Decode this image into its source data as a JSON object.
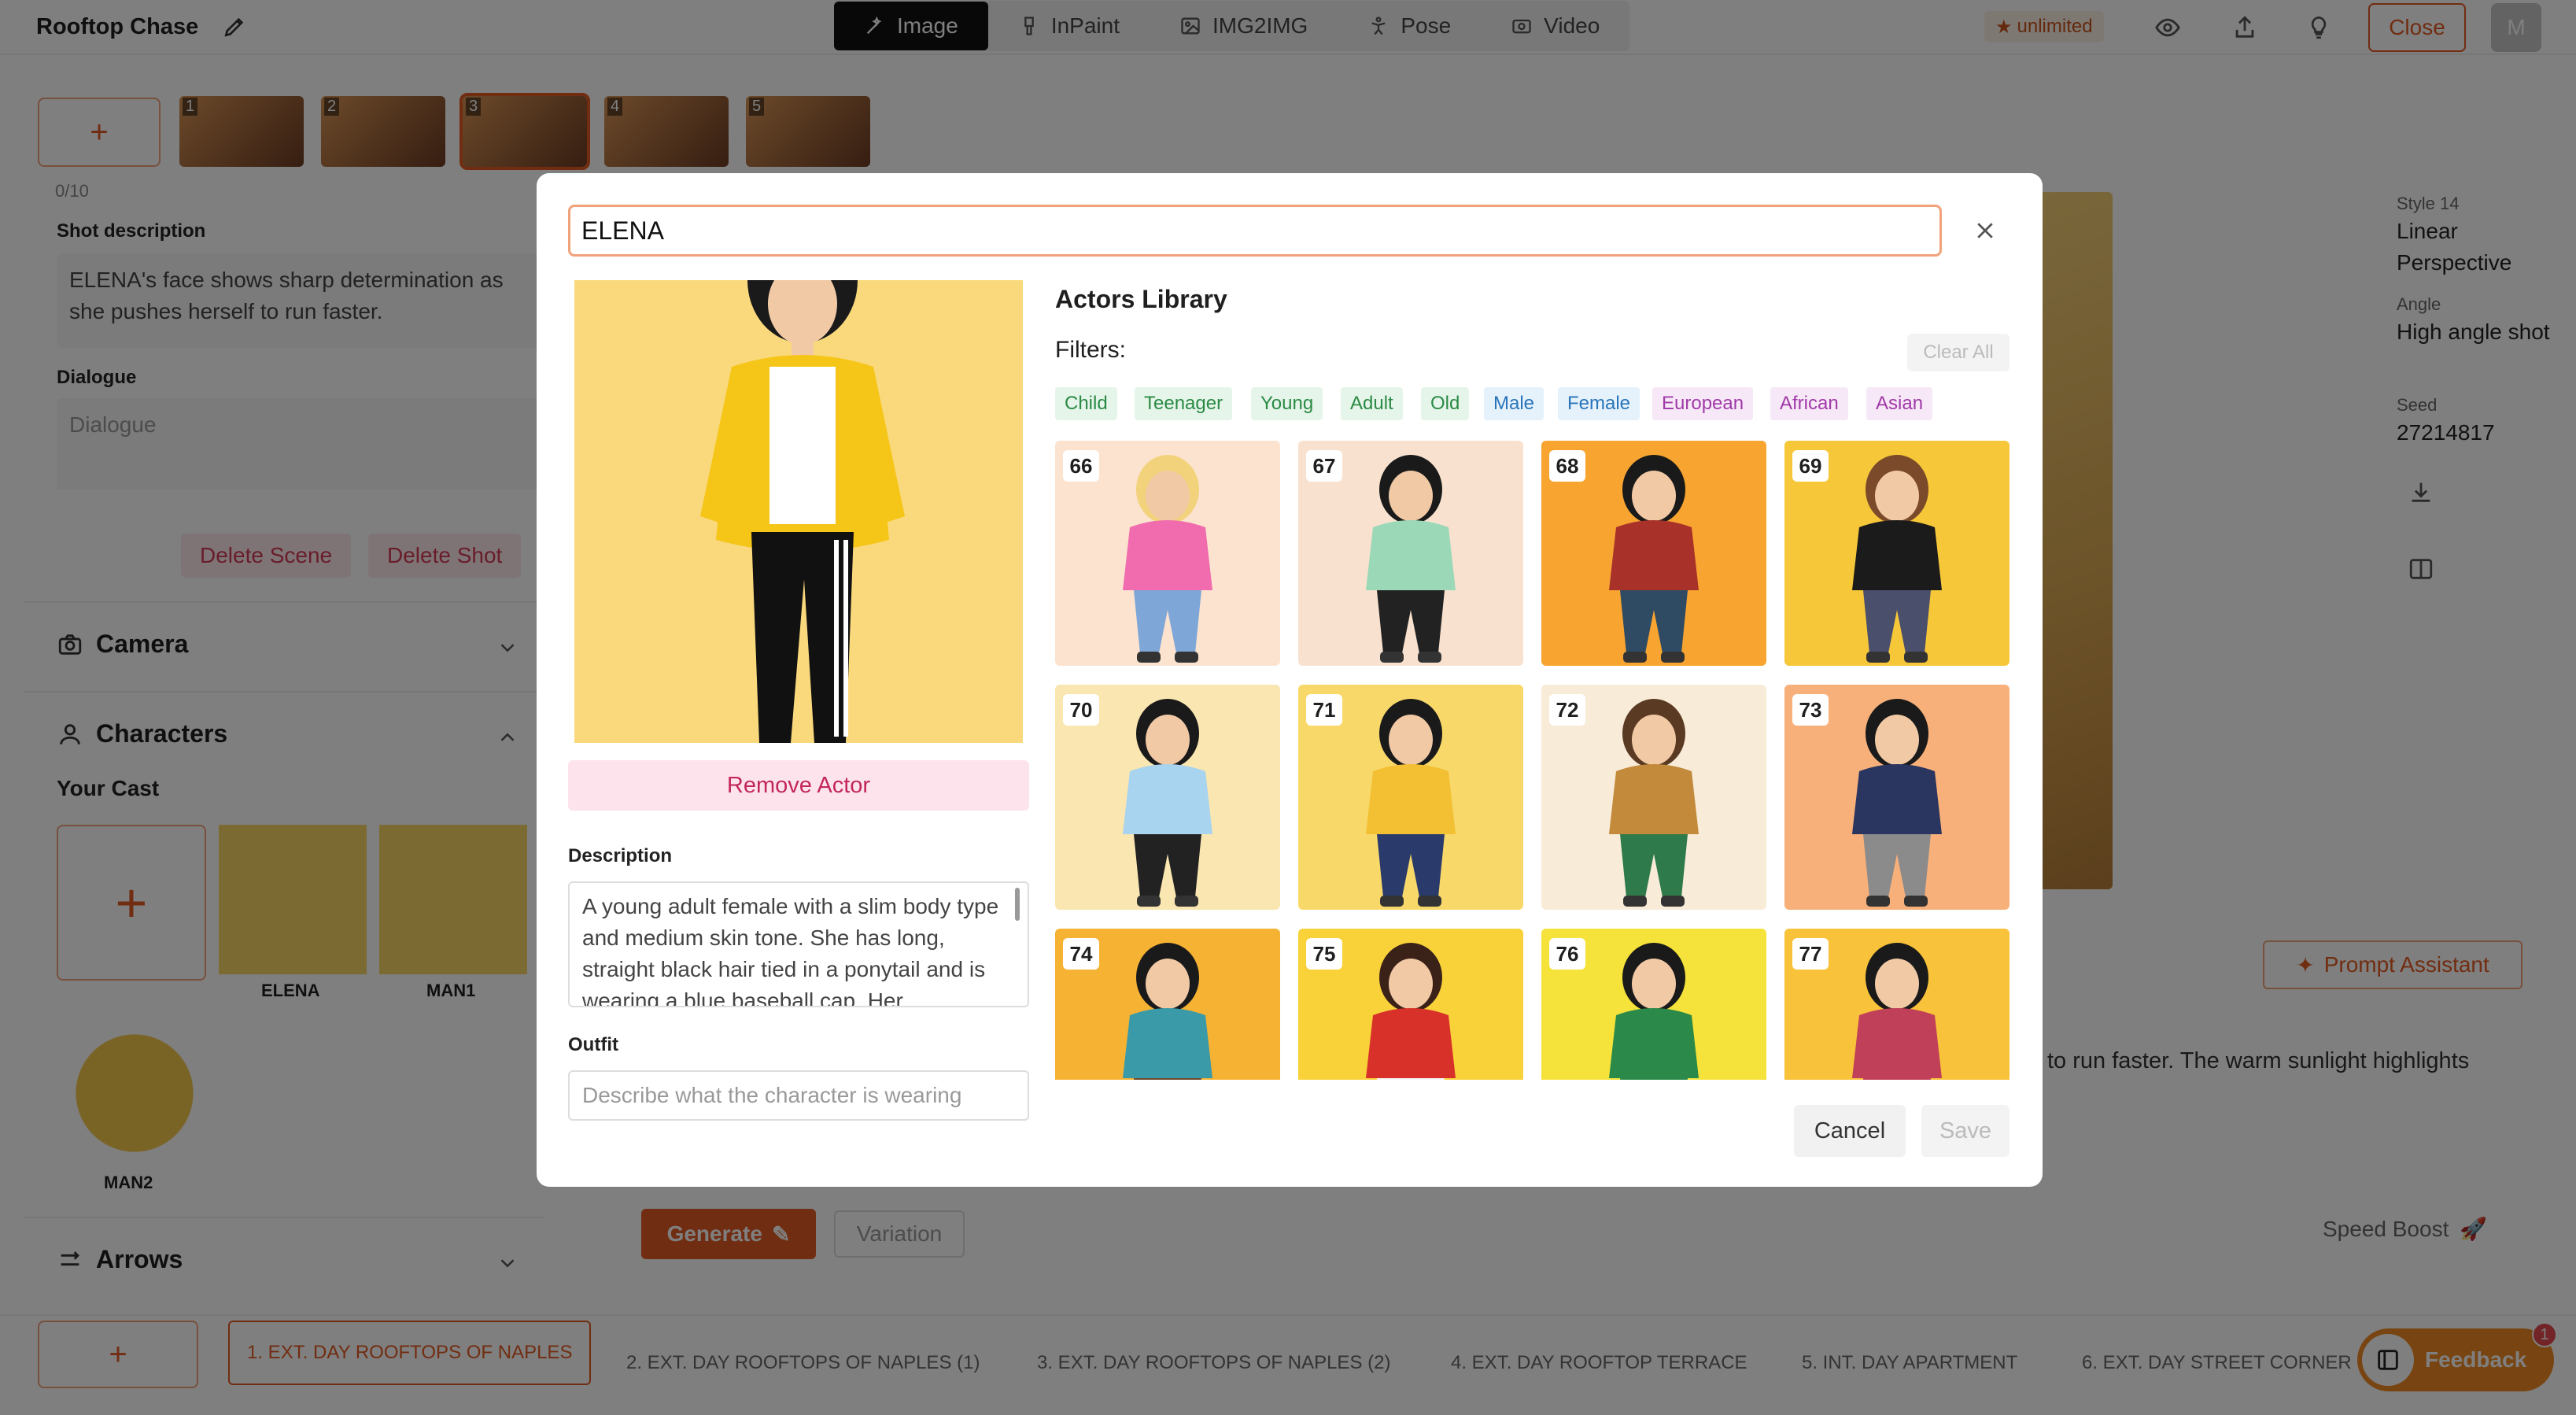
{
  "app": {
    "project_title": "Rooftop Chase",
    "modes": [
      {
        "label": "Image",
        "icon": "magic-wand-icon",
        "active": true
      },
      {
        "label": "InPaint",
        "icon": "brush-icon",
        "active": false
      },
      {
        "label": "IMG2IMG",
        "icon": "image-icon",
        "active": false
      },
      {
        "label": "Pose",
        "icon": "pose-icon",
        "active": false
      },
      {
        "label": "Video",
        "icon": "video-icon",
        "active": false
      }
    ],
    "unlimited_label": "unlimited",
    "close_label": "Close",
    "avatar_initial": "M",
    "accent_color": "#e35b22"
  },
  "shots": [
    "1",
    "2",
    "3",
    "4",
    "5"
  ],
  "sidebar": {
    "counter": "0/10",
    "shot_description_label": "Shot description",
    "shot_description": "ELENA's face shows sharp determination as she pushes herself to run faster.",
    "dialogue_label": "Dialogue",
    "dialogue_placeholder": "Dialogue",
    "delete_scene": "Delete Scene",
    "delete_shot": "Delete Shot",
    "camera_label": "Camera",
    "characters_label": "Characters",
    "cast_label": "Your Cast",
    "cast": [
      "ELENA",
      "MAN1",
      "MAN2"
    ],
    "arrows_label": "Arrows"
  },
  "right_panel": {
    "style_label": "Style 14",
    "style_value": "Linear Perspective",
    "angle_label": "Angle",
    "angle_value": "High angle shot",
    "seed_label": "Seed",
    "seed_value": "27214817",
    "prompt_assistant": "Prompt Assistant",
    "prompt_fragment": "to run faster. The warm sunlight highlights"
  },
  "actions": {
    "generate": "Generate",
    "variation": "Variation",
    "speed_boost": "Speed Boost"
  },
  "scenes": [
    "1. EXT. DAY ROOFTOPS OF NAPLES",
    "2. EXT. DAY ROOFTOPS OF NAPLES (1)",
    "3. EXT. DAY ROOFTOPS OF NAPLES (2)",
    "4. EXT. DAY ROOFTOP TERRACE",
    "5. INT. DAY APARTMENT",
    "6. EXT. DAY STREET CORNER"
  ],
  "feedback": {
    "label": "Feedback",
    "badge": "1"
  },
  "modal": {
    "search_value": "ELENA",
    "remove_actor": "Remove Actor",
    "description_label": "Description",
    "description": "A young adult female with a slim body type and medium skin tone. She has long, straight black hair tied in a ponytail and is wearing a blue baseball cap. Her",
    "outfit_label": "Outfit",
    "outfit_placeholder": "Describe what the character is wearing",
    "library_title": "Actors Library",
    "filters_label": "Filters:",
    "clear_all": "Clear All",
    "filters": [
      {
        "label": "Child",
        "group": "age"
      },
      {
        "label": "Teenager",
        "group": "age"
      },
      {
        "label": "Young",
        "group": "age"
      },
      {
        "label": "Adult",
        "group": "age"
      },
      {
        "label": "Old",
        "group": "age"
      },
      {
        "label": "Male",
        "group": "gender"
      },
      {
        "label": "Female",
        "group": "gender"
      },
      {
        "label": "European",
        "group": "eth"
      },
      {
        "label": "African",
        "group": "eth"
      },
      {
        "label": "Asian",
        "group": "eth"
      }
    ],
    "actors": [
      {
        "id": "66",
        "bg": "#fbe3cf",
        "top": "#f06cae",
        "bottom": "#7ea6d6",
        "hair": "#f2d27a"
      },
      {
        "id": "67",
        "bg": "#f8e2cf",
        "top": "#9bd8b8",
        "bottom": "#222222",
        "hair": "#1a1a1a"
      },
      {
        "id": "68",
        "bg": "#f7a430",
        "top": "#a8322a",
        "bottom": "#2f4b63",
        "hair": "#1a1a1a"
      },
      {
        "id": "69",
        "bg": "#f6c739",
        "top": "#1b1b1b",
        "bottom": "#4a4f6b",
        "hair": "#7a4a2a"
      },
      {
        "id": "70",
        "bg": "#fae6b0",
        "top": "#a8d4f0",
        "bottom": "#222222",
        "hair": "#1a1a1a"
      },
      {
        "id": "71",
        "bg": "#f9d86a",
        "top": "#f2c032",
        "bottom": "#2a3b6b",
        "hair": "#1a1a1a"
      },
      {
        "id": "72",
        "bg": "#f8ecd9",
        "top": "#c28a3a",
        "bottom": "#2f7a4a",
        "hair": "#5a3a22"
      },
      {
        "id": "73",
        "bg": "#f8b07a",
        "top": "#2a3560",
        "bottom": "#8b8b8b",
        "hair": "#1a1a1a"
      },
      {
        "id": "74",
        "bg": "#f6b233",
        "top": "#3a9aa8",
        "bottom": "#6b4a2a",
        "hair": "#1a1a1a"
      },
      {
        "id": "75",
        "bg": "#f9d23a",
        "top": "#d8312a",
        "bottom": "#f4f4f4",
        "hair": "#3a2218"
      },
      {
        "id": "76",
        "bg": "#f5e23a",
        "top": "#2b8a4a",
        "bottom": "#2b8a4a",
        "hair": "#1a1a1a"
      },
      {
        "id": "77",
        "bg": "#f8c23a",
        "top": "#c0405a",
        "bottom": "#c0405a",
        "hair": "#1a1a1a"
      }
    ],
    "cancel": "Cancel",
    "save": "Save"
  }
}
